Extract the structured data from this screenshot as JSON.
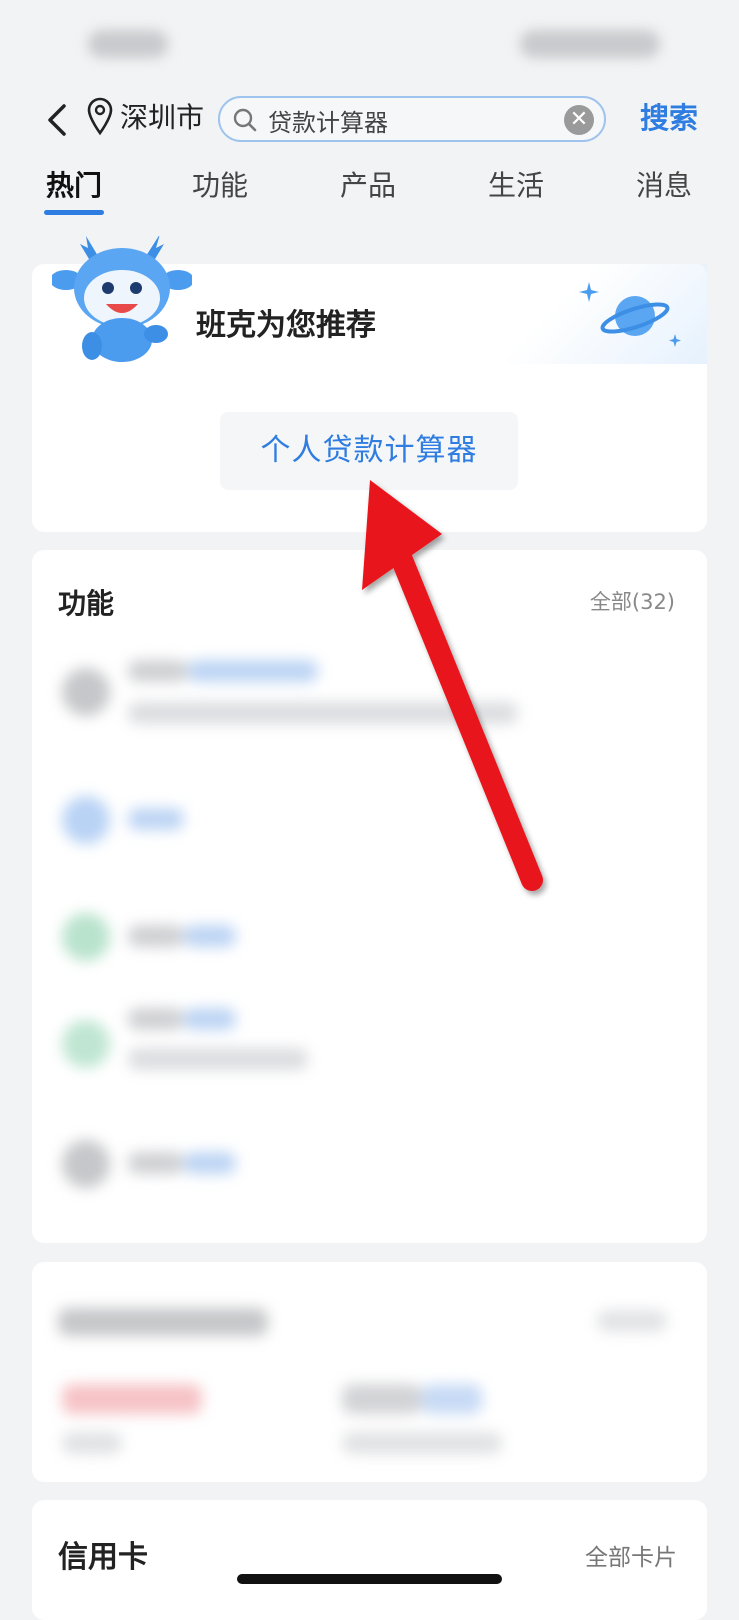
{
  "header": {
    "city": "深圳市",
    "search_value": "贷款计算器",
    "search_button": "搜索"
  },
  "tabs": [
    "热门",
    "功能",
    "产品",
    "生活",
    "消息"
  ],
  "active_tab": 0,
  "recommend": {
    "title": "班克为您推荐",
    "item": "个人贷款计算器"
  },
  "functions": {
    "title": "功能",
    "all": "全部(32)"
  },
  "credit": {
    "title": "信用卡",
    "all": "全部卡片"
  },
  "colors": {
    "accent": "#2f7de0",
    "annotation_arrow": "#e8141c"
  },
  "icons": [
    "back-icon",
    "location-pin-icon",
    "search-icon",
    "clear-icon",
    "mascot-icon",
    "planet-icon"
  ]
}
